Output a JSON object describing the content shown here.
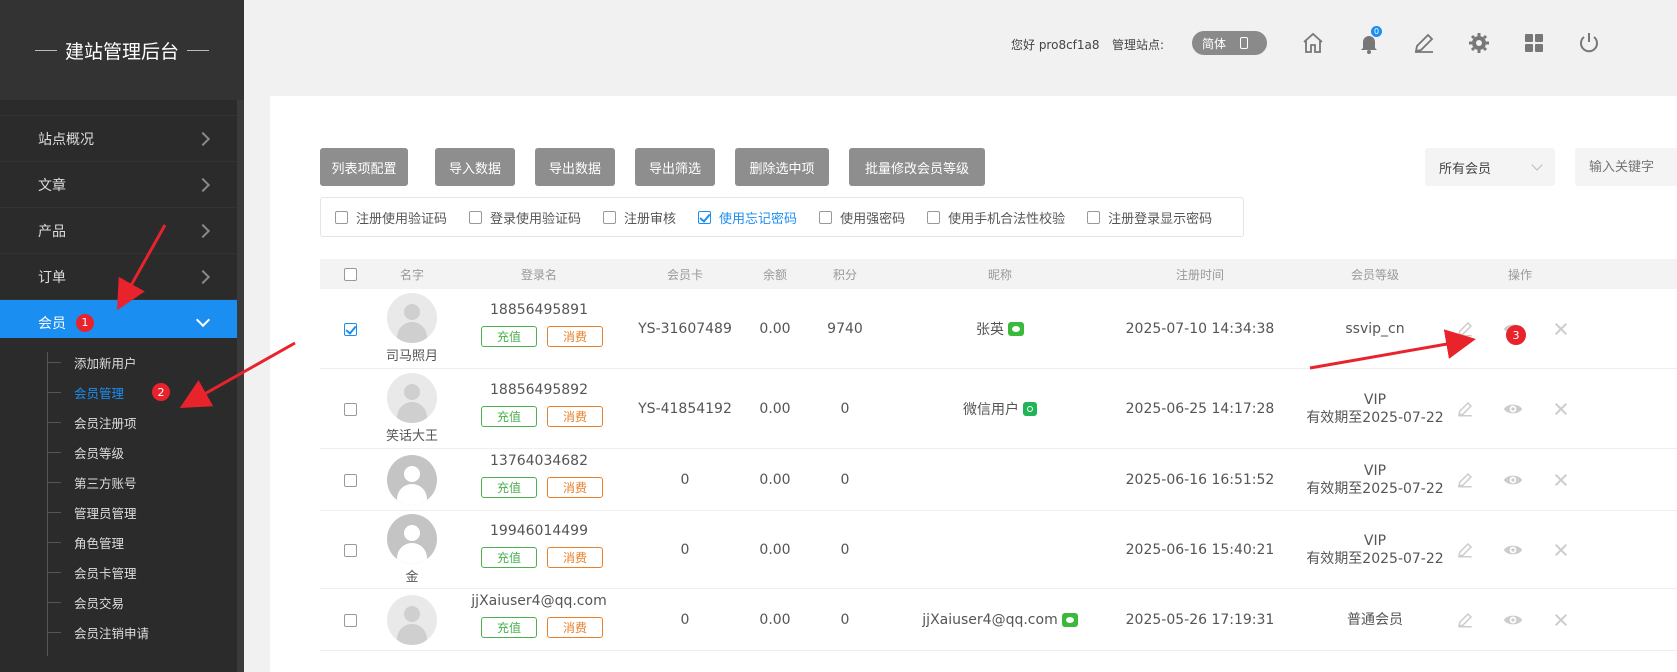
{
  "brand": {
    "title": "建站管理后台"
  },
  "sidebar": {
    "items": [
      {
        "label": "站点概况"
      },
      {
        "label": "文章"
      },
      {
        "label": "产品"
      },
      {
        "label": "订单"
      },
      {
        "label": "会员",
        "badge": "1"
      }
    ],
    "submenu": [
      {
        "label": "添加新用户"
      },
      {
        "label": "会员管理",
        "badge": "2"
      },
      {
        "label": "会员注册项"
      },
      {
        "label": "会员等级"
      },
      {
        "label": "第三方账号"
      },
      {
        "label": "管理员管理"
      },
      {
        "label": "角色管理"
      },
      {
        "label": "会员卡管理"
      },
      {
        "label": "会员交易"
      },
      {
        "label": "会员注销申请"
      }
    ]
  },
  "header": {
    "greeting": "您好 pro8cf1a8",
    "site_label": "管理站点:",
    "lang": "简体",
    "bell_count": "0",
    "icons": [
      "home-icon",
      "bell-icon",
      "edit-icon",
      "gear-icon",
      "grid-icon",
      "power-icon"
    ]
  },
  "toolbar": {
    "buttons": [
      "列表项配置",
      "导入数据",
      "导出数据",
      "导出筛选",
      "删除选中项",
      "批量修改会员等级"
    ],
    "filter_value": "所有会员",
    "search_placeholder": "输入关键字"
  },
  "options": [
    {
      "label": "注册使用验证码",
      "checked": false
    },
    {
      "label": "登录使用验证码",
      "checked": false
    },
    {
      "label": "注册审核",
      "checked": false
    },
    {
      "label": "使用忘记密码",
      "checked": true
    },
    {
      "label": "使用强密码",
      "checked": false
    },
    {
      "label": "使用手机合法性校验",
      "checked": false
    },
    {
      "label": "注册登录显示密码",
      "checked": false
    }
  ],
  "table": {
    "headers": [
      "名字",
      "登录名",
      "会员卡",
      "余额",
      "积分",
      "昵称",
      "注册时间",
      "会员等级",
      "操作"
    ],
    "recharge_label": "充值",
    "spend_label": "消费",
    "rows": [
      {
        "name": "司马照月",
        "login": "18856495891",
        "card": "YS-31607489",
        "balance": "0.00",
        "points": "9740",
        "nick": "张英",
        "nick_icon": "wechat-icon",
        "time": "2025-07-10 14:34:38",
        "level": "ssvip_cn",
        "level2": "",
        "checked": true
      },
      {
        "name": "笑话大王",
        "login": "18856495892",
        "card": "YS-41854192",
        "balance": "0.00",
        "points": "0",
        "nick": "微信用户",
        "nick_icon": "miniprogram-icon",
        "time": "2025-06-25 14:17:28",
        "level": "VIP",
        "level2": "有效期至2025-07-22",
        "checked": false
      },
      {
        "name": "",
        "login": "13764034682",
        "card": "0",
        "balance": "0.00",
        "points": "0",
        "nick": "",
        "nick_icon": "",
        "time": "2025-06-16 16:51:52",
        "level": "VIP",
        "level2": "有效期至2025-07-22",
        "checked": false
      },
      {
        "name": "金",
        "login": "19946014499",
        "card": "0",
        "balance": "0.00",
        "points": "0",
        "nick": "",
        "nick_icon": "",
        "time": "2025-06-16 15:40:21",
        "level": "VIP",
        "level2": "有效期至2025-07-22",
        "checked": false
      },
      {
        "name": "",
        "login": "jjXaiuser4@qq.com",
        "card": "0",
        "balance": "0.00",
        "points": "0",
        "nick": "jjXaiuser4@qq.com",
        "nick_icon": "wechat-icon",
        "time": "2025-05-26 17:19:31",
        "level": "普通会员",
        "level2": "",
        "checked": false
      }
    ]
  },
  "annotations": {
    "marker3": "3"
  },
  "colors": {
    "accent": "#1b8ef2",
    "sidebar": "#2b2b2b",
    "badge": "#e8232b",
    "recharge": "#4caf50",
    "spend": "#e8802b"
  }
}
